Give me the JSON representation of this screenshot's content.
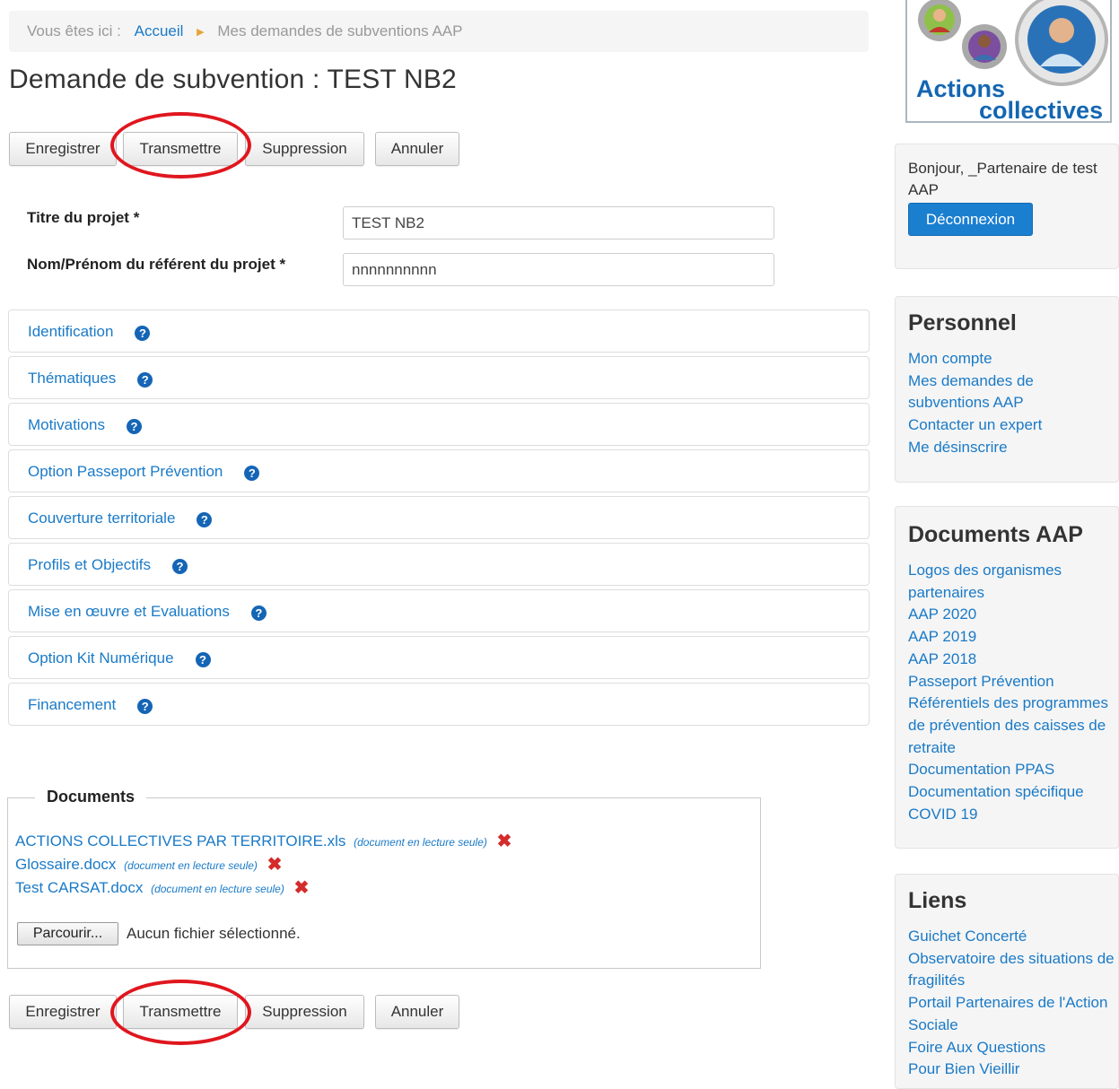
{
  "breadcrumb": {
    "prefix": "Vous êtes ici :",
    "home": "Accueil",
    "separator": "▶",
    "current": "Mes demandes de subventions AAP"
  },
  "page_title": "Demande de subvention : TEST NB2",
  "actions": {
    "save": "Enregistrer",
    "transmit": "Transmettre",
    "delete": "Suppression",
    "cancel": "Annuler"
  },
  "highlight_color": "#e0161e",
  "form": {
    "project_title_label": "Titre du projet *",
    "project_title_value": "TEST NB2",
    "referent_label": "Nom/Prénom du référent du projet *",
    "referent_value": "nnnnnnnnnn"
  },
  "help_icon": "question-circle-icon",
  "sections": [
    "Identification",
    "Thématiques",
    "Motivations",
    "Option Passeport Prévention",
    "Couverture territoriale",
    "Profils et Objectifs",
    "Mise en œuvre et Evaluations",
    "Option Kit Numérique",
    "Financement"
  ],
  "documents": {
    "legend": "Documents",
    "read_only_note": "(document en lecture seule)",
    "files": [
      "ACTIONS COLLECTIVES PAR TERRITOIRE.xls",
      "Glossaire.docx",
      "Test CARSAT.docx"
    ],
    "delete_icon": "red-x-icon",
    "browse_button": "Parcourir...",
    "no_file": "Aucun fichier sélectionné."
  },
  "sidebar": {
    "logo": {
      "line1": "Actions",
      "line2": "collectives"
    },
    "user": {
      "greeting": "Bonjour, _Partenaire de test AAP",
      "logout": "Déconnexion"
    },
    "personnel": {
      "title": "Personnel",
      "links": [
        "Mon compte",
        "Mes demandes de subventions AAP",
        "Contacter un expert",
        "Me désinscrire"
      ]
    },
    "documents_aap": {
      "title": "Documents AAP",
      "links": [
        "Logos des organismes partenaires",
        "AAP 2020",
        "AAP 2019",
        "AAP 2018",
        "Passeport Prévention",
        "Référentiels des programmes de prévention des caisses de retraite",
        "Documentation PPAS",
        "Documentation spécifique COVID 19"
      ]
    },
    "liens": {
      "title": "Liens",
      "links": [
        "Guichet Concerté",
        "Observatoire des situations de fragilités",
        "Portail Partenaires de l'Action Sociale",
        "Foire Aux Questions",
        "Pour Bien Vieillir"
      ]
    }
  },
  "colors": {
    "link": "#1a7ac7",
    "primary_button": "#1b7fd0",
    "help_icon": "#1565b6"
  }
}
